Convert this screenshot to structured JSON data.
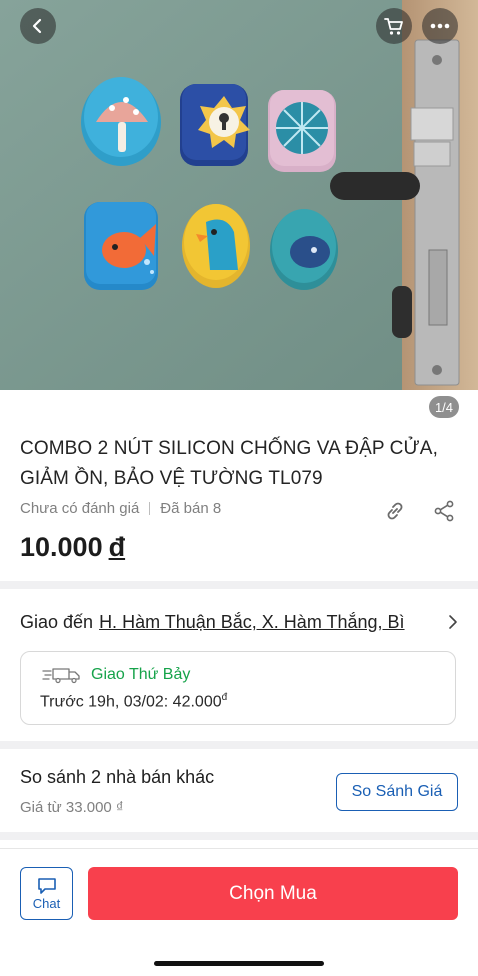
{
  "gallery": {
    "pager": "1/4",
    "back_icon": "chevron-left-icon",
    "cart_icon": "cart-icon",
    "more_icon": "more-icon"
  },
  "product": {
    "title": "COMBO 2 NÚT SILICON CHỐNG VA ĐẬP CỬA, GIẢM ỒN, BẢO VỆ TƯỜNG TL079",
    "rating_text": "Chưa có đánh giá",
    "sold_text": "Đã bán 8",
    "price_value": "10.000",
    "price_currency": "đ"
  },
  "shipping": {
    "label": "Giao đến",
    "address": "H. Hàm Thuận Bắc, X. Hàm Thắng, Bì",
    "method": "Giao Thứ Bảy",
    "detail": "Trước 19h, 03/02: 42.000",
    "detail_currency": "đ"
  },
  "compare": {
    "title": "So sánh 2 nhà bán khác",
    "subtitle": "Giá từ 33.000 ₫",
    "button": "So Sánh Giá"
  },
  "actions": {
    "chat": "Chat",
    "buy": "Chọn Mua"
  },
  "colors": {
    "accent_blue": "#1a5fb4",
    "buy_red": "#f8404d",
    "ship_green": "#16a34a"
  }
}
